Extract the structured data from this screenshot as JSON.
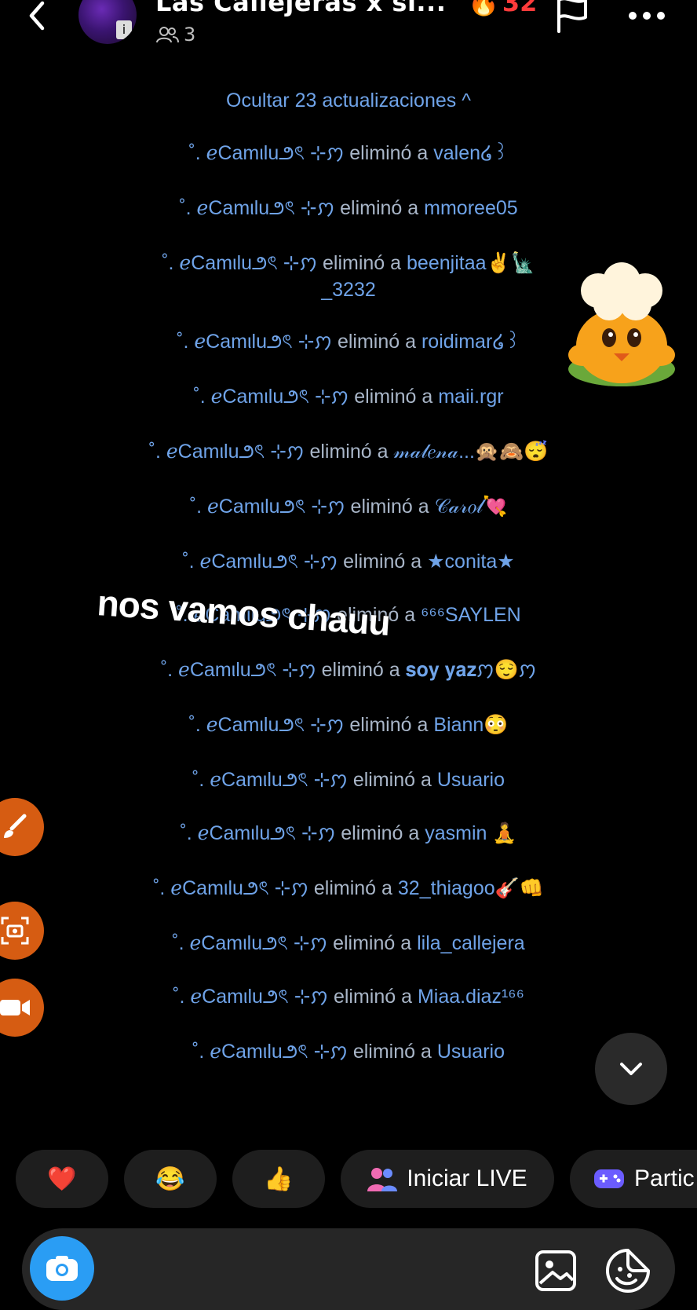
{
  "header": {
    "title": "Las Callejeras x si...",
    "members_count": "3",
    "streak": "32",
    "icons": {
      "back": "chevron-left-icon",
      "members": "people-icon",
      "streak": "fire-icon",
      "flag": "flag-icon",
      "more": "more-icon"
    }
  },
  "updates_toggle": "Ocultar 23 actualizaciones ^",
  "actor": "˚. ℯCamιlu౨ৎ ⊹ꩀ",
  "verb": "eliminó a",
  "updates": [
    {
      "target": "valen໒꒱"
    },
    {
      "target": "mmoree05"
    },
    {
      "target": "beenjitaa✌🗽",
      "target2": "_3232"
    },
    {
      "target": "roidimar໒꒱"
    },
    {
      "target": "maii.rgr"
    },
    {
      "target": "𝓂𝒶𝓁𝑒𝓃𝒶...🙊🙈😴"
    },
    {
      "target": "𝒞𝒶𝓇𝑜𝓁💘"
    },
    {
      "target": "★conita★"
    },
    {
      "target": "⁶⁶⁶SAYLEN"
    },
    {
      "target": "𝐬𝐨𝐲 𝐲𝐚𝐳ꩀ😌ꩀ"
    },
    {
      "target": "Biann😳"
    },
    {
      "target": "Usuario"
    },
    {
      "target": "yasmin 🧘"
    },
    {
      "target": "32_thiagoo🎸👊"
    },
    {
      "target": "lila_callejera"
    },
    {
      "target": "Miaa.diaz¹⁶⁶"
    },
    {
      "target": "Usuario"
    }
  ],
  "overlay_text": "nos vamos chauu",
  "quick_replies": {
    "heart": "❤️",
    "laugh": "😂",
    "thumbs": "👍",
    "live_label": "Iniciar LIVE",
    "games_label": "Partic"
  },
  "colors": {
    "link": "#6fa3e8",
    "accent": "#2a9df4",
    "tool": "#d65c12",
    "chip": "#1e1e1e"
  }
}
